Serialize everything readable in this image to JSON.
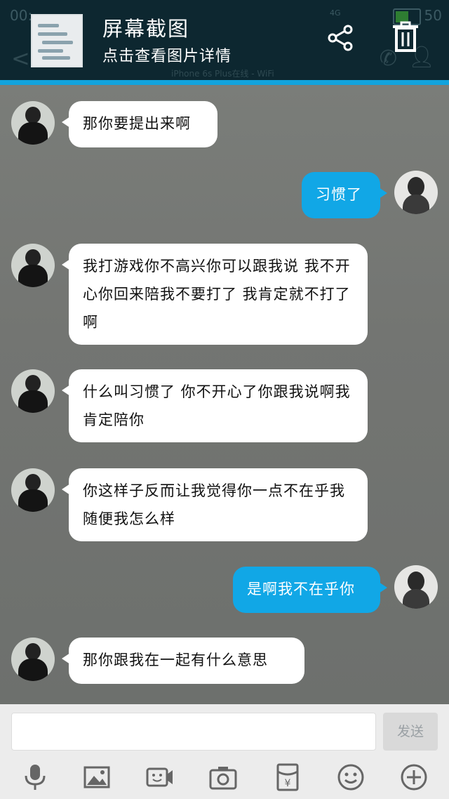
{
  "status_bar": {
    "time": "00:",
    "battery_level": "50",
    "signal_label": "4G",
    "battery_fill": 0.6
  },
  "background_header": {
    "back_glyph": "<",
    "subtitle": "iPhone 6s Plus在线 - WiFi"
  },
  "screenshot_banner": {
    "title": "屏幕截图",
    "subtitle": "点击查看图片详情",
    "share_icon": "share-icon",
    "delete_icon": "trash-icon"
  },
  "messages": [
    {
      "side": "left",
      "text": "那你要提出来啊"
    },
    {
      "side": "right",
      "text": "习惯了"
    },
    {
      "side": "left",
      "text": "我打游戏你不高兴你可以跟我说 我不开心你回来陪我不要打了  我肯定就不打了啊"
    },
    {
      "side": "left",
      "text": "什么叫习惯了   你不开心了你跟我说啊我肯定陪你"
    },
    {
      "side": "left",
      "text": "你这样子反而让我觉得你一点不在乎我  随便我怎么样"
    },
    {
      "side": "right",
      "text": "是啊我不在乎你"
    },
    {
      "side": "left",
      "text": "那你跟我在一起有什么意思"
    }
  ],
  "composer": {
    "input_value": "",
    "send_label": "发送"
  },
  "toolbar": [
    "mic-icon",
    "image-icon",
    "video-icon",
    "camera-icon",
    "red-packet-icon",
    "emoji-icon",
    "plus-icon"
  ],
  "colors": {
    "header": "#0d2730",
    "accent_line": "#12a3dd",
    "bubble_right": "#11a7e6",
    "bubble_left": "#ffffff"
  }
}
